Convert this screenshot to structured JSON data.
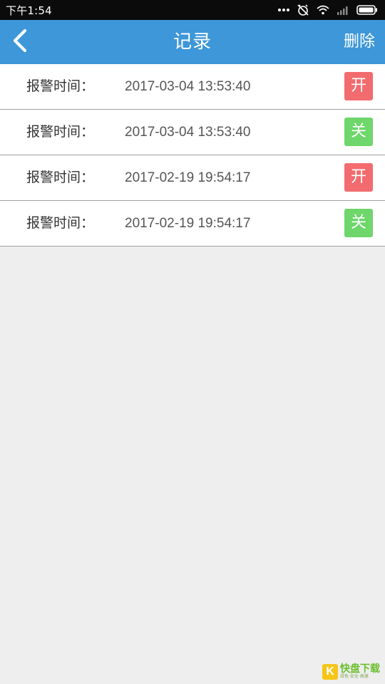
{
  "status_bar": {
    "time": "下午1:54",
    "icons": [
      "more-dots-icon",
      "alarm-off-icon",
      "wifi-icon",
      "signal-icon",
      "battery-icon"
    ]
  },
  "app_bar": {
    "title": "记录",
    "back_icon": "back-chevron-icon",
    "delete_label": "删除",
    "background": "#3d97d8"
  },
  "records": [
    {
      "label": "报警时间：",
      "time": "2017-03-04 13:53:40",
      "state": "开",
      "state_color": "#f26b6e"
    },
    {
      "label": "报警时间：",
      "time": "2017-03-04 13:53:40",
      "state": "关",
      "state_color": "#6ed66a"
    },
    {
      "label": "报警时间：",
      "time": "2017-02-19 19:54:17",
      "state": "开",
      "state_color": "#f26b6e"
    },
    {
      "label": "报警时间：",
      "time": "2017-02-19 19:54:17",
      "state": "关",
      "state_color": "#6ed66a"
    }
  ],
  "watermark": {
    "logo_letter": "K",
    "text": "快盘下载",
    "sub": "绿色·安全·高速"
  }
}
